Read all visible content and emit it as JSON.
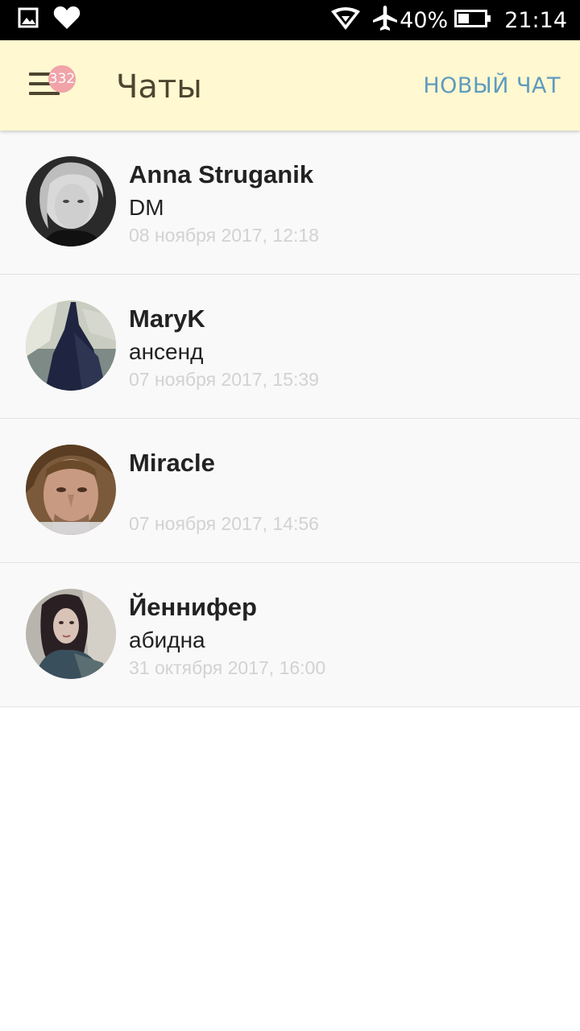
{
  "status_bar": {
    "icons_left": [
      "image-icon",
      "heart-icon"
    ],
    "icons_right": [
      "wifi-icon",
      "airplane-icon",
      "battery-icon"
    ],
    "battery": "40%",
    "time": "21:14",
    "colors": {
      "background": "#000000",
      "foreground": "#ffffff"
    }
  },
  "app_bar": {
    "menu_icon": "hamburger-menu-icon",
    "badge": "332",
    "title": "Чаты",
    "new_chat_label": "НОВЫЙ ЧАТ",
    "colors": {
      "background": "#fff8d0",
      "title": "#4d4530",
      "badge": "#f0a3a8",
      "action": "#5e9bbf"
    }
  },
  "chats": [
    {
      "name": "Anna Struganik",
      "last_message": "DM",
      "time": "08 ноября 2017, 12:18"
    },
    {
      "name": "MaryK",
      "last_message": "ансенд",
      "time": "07 ноября 2017, 15:39"
    },
    {
      "name": "Miracle",
      "last_message": "",
      "time": "07 ноября 2017, 14:56"
    },
    {
      "name": "Йеннифер",
      "last_message": "абидна",
      "time": "31 октября 2017, 16:00"
    }
  ]
}
